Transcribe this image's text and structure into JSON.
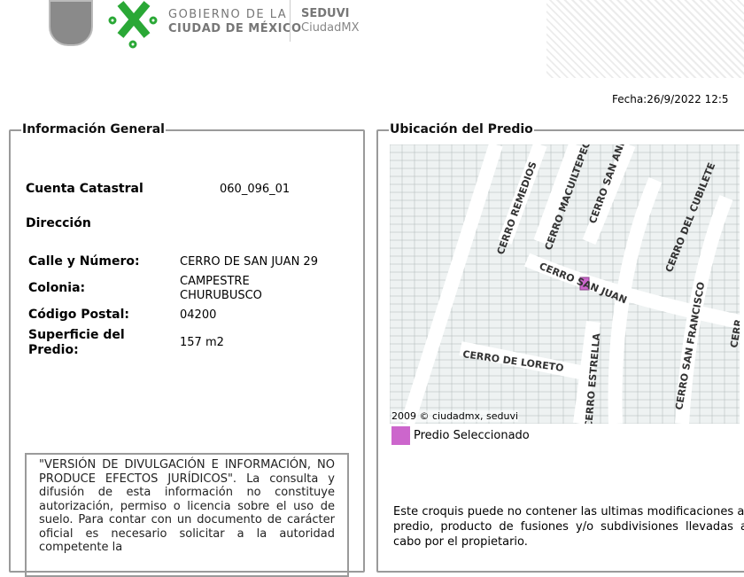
{
  "header": {
    "gov_line1": "GOBIERNO DE LA",
    "gov_line2": "CIUDAD DE MÉXICO",
    "agency": "SEDUVI",
    "agency_sub": "CiudadMX",
    "date": "Fecha:26/9/2022 12:5",
    "colors": {
      "green": "#2aa836",
      "gray": "#808080"
    }
  },
  "info": {
    "title": "Información General",
    "cuenta_label": "Cuenta Catastral",
    "cuenta_value": "060_096_01",
    "direccion_label": "Dirección",
    "calle_label": "Calle y Número:",
    "calle_value": "CERRO DE SAN JUAN 29",
    "colonia_label": "Colonia:",
    "colonia_value1": "CAMPESTRE",
    "colonia_value2": "CHURUBUSCO",
    "cp_label": "Código Postal:",
    "cp_value": "04200",
    "sup_label1": "Superficie del",
    "sup_label2": "Predio:",
    "sup_value": "157 m2",
    "disclaimer": "\"VERSIÓN DE DIVULGACIÓN E INFORMACIÓN, NO PRODUCE EFECTOS JURÍDICOS\". La consulta y difusión de esta información no constituye autorización, permiso o licencia sobre el uso de suelo. Para contar con un documento de carácter oficial es necesario solicitar a la autoridad competente la"
  },
  "location": {
    "title": "Ubicación del Predio",
    "map_credit": "2009 © ciudadmx, seduvi",
    "streets": [
      "CERRO REMEDIOS",
      "CERRO MACUILTEPEC",
      "CERRO SAN ANDRÉS",
      "CERRO DEL CUBILETE",
      "CERRO SAN JUAN",
      "CERRO SAN FRANCISCO",
      "CERRO DE LORETO",
      "CERRO ESTRELLA",
      "CERR"
    ],
    "legend_label": "Predio Seleccionado",
    "legend_color": "#cc66cc",
    "note": "Este croquis puede no contener las ultimas modificaciones al predio, producto de fusiones y/o subdivisiones llevadas a cabo por el propietario."
  }
}
